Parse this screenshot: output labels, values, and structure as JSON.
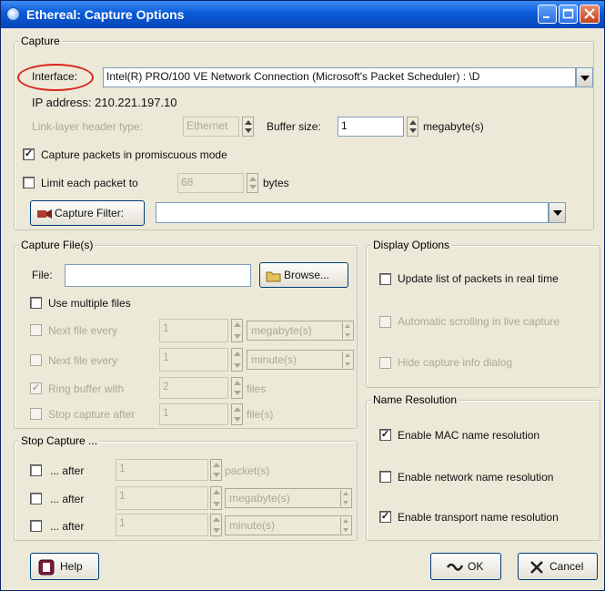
{
  "window": {
    "title": "Ethereal: Capture Options"
  },
  "capture": {
    "group_label": "Capture",
    "interface_label": "Interface:",
    "interface_value": "Intel(R) PRO/100 VE Network Connection (Microsoft's Packet Scheduler) : \\D",
    "ip_address": "IP address: 210.221.197.10",
    "link_layer_label": "Link-layer header type:",
    "link_layer_value": "Ethernet",
    "buffer_label": "Buffer size:",
    "buffer_value": "1",
    "buffer_unit": "megabyte(s)",
    "promiscuous_label": "Capture packets in promiscuous mode",
    "promiscuous_checked": true,
    "limit_label": "Limit each packet to",
    "limit_value": "68",
    "limit_unit": "bytes",
    "capture_filter_button": "Capture Filter:",
    "capture_filter_value": ""
  },
  "capture_files": {
    "group_label": "Capture File(s)",
    "file_label": "File:",
    "file_value": "",
    "browse_button": "Browse...",
    "use_multiple_label": "Use multiple files",
    "rows": [
      {
        "label": "Next file every",
        "value": "1",
        "unit": "megabyte(s)"
      },
      {
        "label": "Next file every",
        "value": "1",
        "unit": "minute(s)"
      },
      {
        "label": "Ring buffer with",
        "value": "2",
        "unit": "files"
      },
      {
        "label": "Stop capture after",
        "value": "1",
        "unit": "file(s)"
      }
    ]
  },
  "stop_capture": {
    "group_label": "Stop Capture ...",
    "rows": [
      {
        "label": "... after",
        "value": "1",
        "unit": "packet(s)"
      },
      {
        "label": "... after",
        "value": "1",
        "unit": "megabyte(s)"
      },
      {
        "label": "... after",
        "value": "1",
        "unit": "minute(s)"
      }
    ]
  },
  "display_options": {
    "group_label": "Display Options",
    "update_list_label": "Update list of packets in real time",
    "auto_scroll_label": "Automatic scrolling in live capture",
    "hide_info_label": "Hide capture info dialog"
  },
  "name_resolution": {
    "group_label": "Name Resolution",
    "mac_label": "Enable MAC name resolution",
    "network_label": "Enable network name resolution",
    "transport_label": "Enable transport name resolution"
  },
  "buttons": {
    "help": "Help",
    "ok": "OK",
    "cancel": "Cancel"
  },
  "colors": {
    "titlebar": "#0a5ad8",
    "highlight_ring": "#d9261c"
  }
}
